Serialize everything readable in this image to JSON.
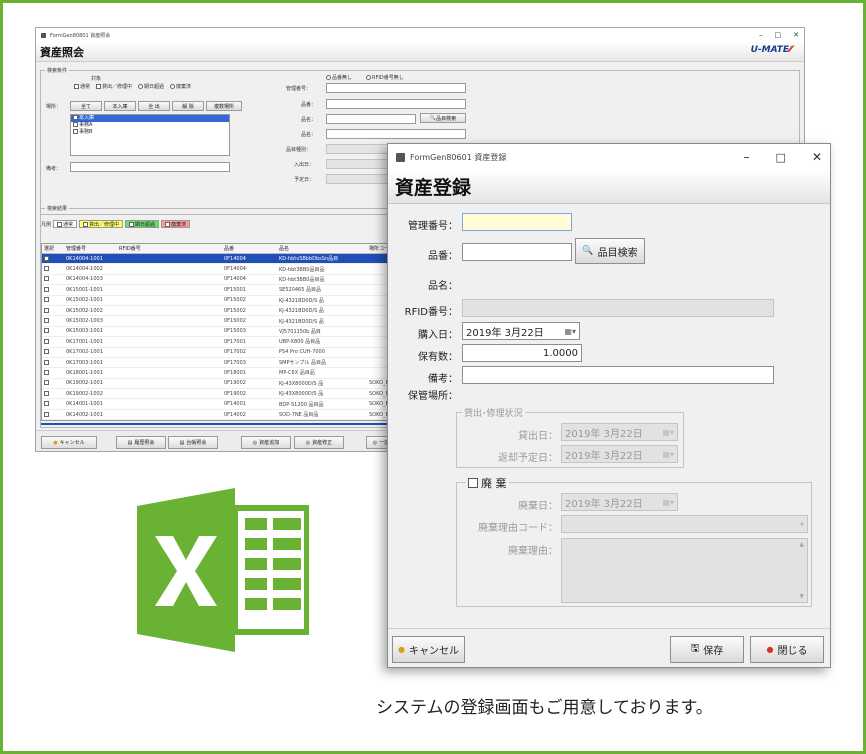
{
  "back_window": {
    "title": "FormGen80801 資産照会",
    "heading": "資産照会",
    "logo_text": "U-MATE",
    "search": {
      "group_label": "検索条件",
      "target_label": "対象",
      "targets": [
        "通常",
        "貸出／修理中",
        "期日超過",
        "廃棄済"
      ],
      "location_label": "場所：",
      "location_buttons": [
        "全て",
        "本入庫",
        "全 出",
        "解 除",
        "複数場所"
      ],
      "locations": [
        "本入庫",
        "事務A",
        "事務B"
      ],
      "remarks_label": "備考：",
      "checkbox_top": [
        "品番無し",
        "RFID番号無し"
      ],
      "fields": [
        "管理番号：",
        "品番：",
        "品名：",
        "品名：",
        "品目種別：",
        "入出日：",
        "予定日："
      ],
      "item_search": "品目検索"
    },
    "results": {
      "group_label": "検索結果",
      "legend": [
        "凡例",
        "通常",
        "貸出／修理中",
        "期日超過",
        "廃棄済"
      ],
      "columns": [
        "選択",
        "管理番号",
        "RFID番号",
        "品番",
        "品名",
        "場所コード"
      ],
      "rows": [
        [
          "",
          "0K14004-1001",
          "",
          "0F14004",
          "KD-hbtvSBbbDbsSn品目",
          ""
        ],
        [
          "",
          "0K14004-1002",
          "",
          "0F14004",
          "KD-hbt3BB0品目品",
          ""
        ],
        [
          "",
          "0K14004-1003",
          "",
          "0F14004",
          "KD-hbt3BB0品目品",
          ""
        ],
        [
          "",
          "0K15001-1001",
          "",
          "0F15001",
          "SE520465 品目品",
          ""
        ],
        [
          "",
          "0K15002-1001",
          "",
          "0F15002",
          "KJ-4321BD0D/S 品",
          ""
        ],
        [
          "",
          "0K15002-1002",
          "",
          "0F15002",
          "KJ-4321BD0D/S 品",
          ""
        ],
        [
          "",
          "0K15002-1003",
          "",
          "0F15002",
          "KJ-4321BD0D/S 品",
          ""
        ],
        [
          "",
          "0K15003-1001",
          "",
          "0F15003",
          "VJ5701150b 品目",
          ""
        ],
        [
          "",
          "0K17001-1001",
          "",
          "0F17001",
          "UBP-X800 品目品",
          ""
        ],
        [
          "",
          "0K17002-1001",
          "",
          "0F17002",
          "PS4 Pro CUH-7000",
          ""
        ],
        [
          "",
          "0K17003-1001",
          "",
          "0F17003",
          "SMPサンプル 品目品",
          ""
        ],
        [
          "",
          "0K18001-1001",
          "",
          "0F18001",
          "MP-C6X 品目品",
          ""
        ],
        [
          "",
          "0K19002-1001",
          "",
          "0F19002",
          "KJ-43X8000D/S 品",
          "SOKO_B"
        ],
        [
          "",
          "0K19002-1002",
          "",
          "0F19002",
          "KJ-43X8000D/S 品",
          "SOKO_B"
        ],
        [
          "",
          "0K14001-1001",
          "",
          "0F14001",
          "BDP-S1200 品目品",
          "SOKO_B"
        ],
        [
          "",
          "0K14002-1001",
          "",
          "0F14002",
          "SOD-7NE 品目品",
          "SOKO_B"
        ]
      ]
    },
    "bottom_buttons": [
      "キャンセル",
      "履歴照会",
      "台帳照会",
      "資産追加",
      "資産修正",
      "一括"
    ]
  },
  "front_window": {
    "title": "FormGen80601 資産登録",
    "heading": "資産登録",
    "labels": {
      "control_no": "管理番号：",
      "part_no": "品番：",
      "part_name": "品名：",
      "rfid": "RFID番号：",
      "purchase_date": "購入日：",
      "quantity": "保有数：",
      "remarks": "備考：",
      "storage": "保管場所："
    },
    "values": {
      "control_no": "",
      "part_no": "",
      "rfid": "",
      "purchase_date": "2019年 3月22日",
      "quantity": "1.0000",
      "remarks": ""
    },
    "item_search_button": "品目検索",
    "lending": {
      "group_label": "貸出･修理状況",
      "out_date_label": "貸出日：",
      "out_date": "2019年 3月22日",
      "return_date_label": "返却予定日：",
      "return_date": "2019年 3月22日"
    },
    "disposal": {
      "checkbox_label": "廃 棄",
      "date_label": "廃棄日：",
      "date": "2019年 3月22日",
      "reason_code_label": "廃棄理由コード：",
      "reason_label": "廃棄理由："
    },
    "buttons": {
      "cancel": "キャンセル",
      "save": "保存",
      "close": "閉じる"
    }
  },
  "caption": "システムの登録画面もご用意しております。",
  "colors": {
    "frame": "#6ab233",
    "excel_green": "#6ab233"
  }
}
